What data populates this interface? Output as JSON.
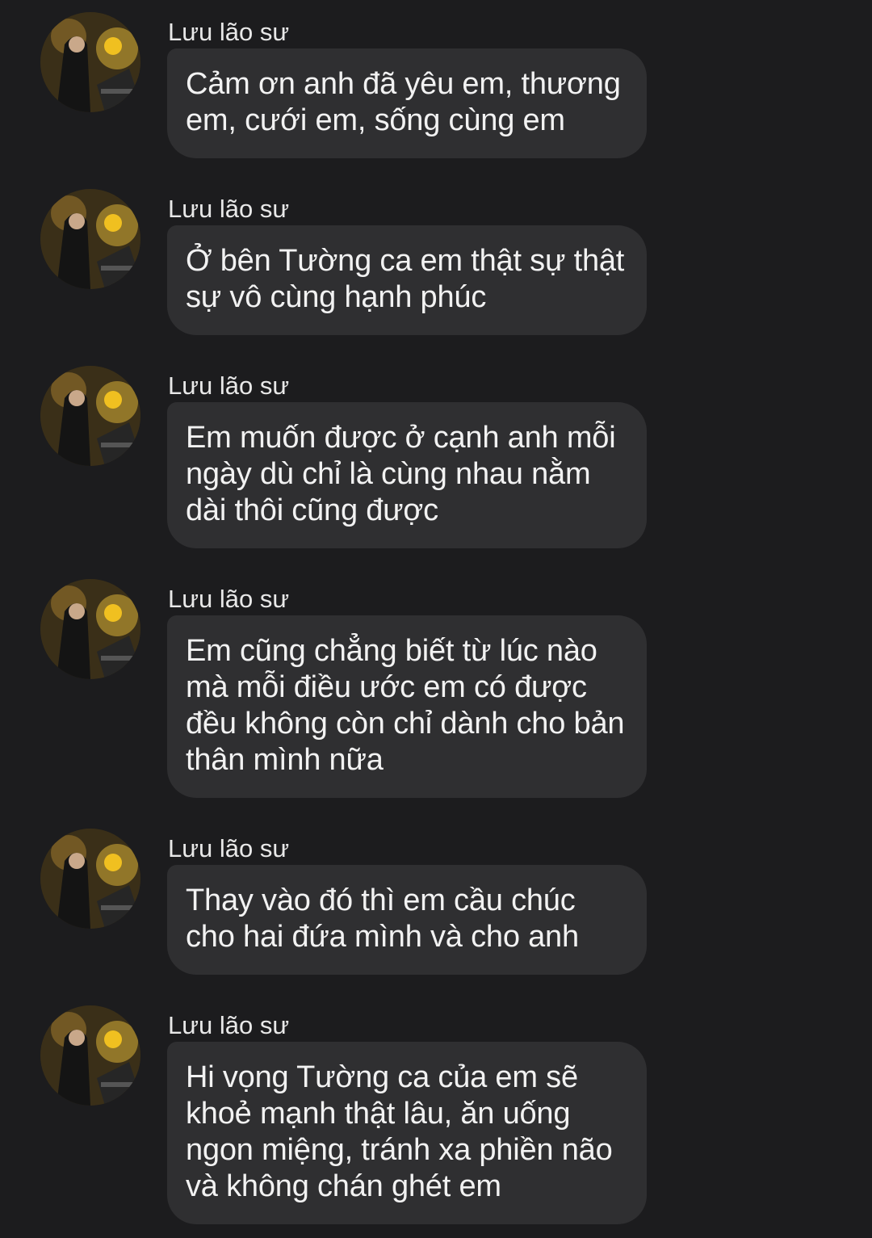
{
  "colors": {
    "background": "#1c1c1e",
    "bubble": "#2f2f31",
    "text": "#f2f2f2",
    "sender_name": "#e8e8e8"
  },
  "messages": [
    {
      "sender": "Lưu lão sư",
      "avatar_icon": "profile-photo-avatar",
      "text": "Cảm ơn anh đã yêu em, thương\nem, cưới em, sống cùng em"
    },
    {
      "sender": "Lưu lão sư",
      "avatar_icon": "profile-photo-avatar",
      "text": "Ở bên Tường ca em thật sự thật\nsự vô cùng hạnh phúc"
    },
    {
      "sender": "Lưu lão sư",
      "avatar_icon": "profile-photo-avatar",
      "text": "Em muốn được ở cạnh anh mỗi\nngày dù chỉ là cùng nhau nằm\ndài thôi cũng được"
    },
    {
      "sender": "Lưu lão sư",
      "avatar_icon": "profile-photo-avatar",
      "text": "Em cũng chẳng biết từ lúc nào\nmà mỗi điều ước em có được\nđều không còn chỉ dành cho bản\nthân mình nữa"
    },
    {
      "sender": "Lưu lão sư",
      "avatar_icon": "profile-photo-avatar",
      "text": "Thay vào đó thì em cầu chúc\ncho hai đứa mình và cho anh"
    },
    {
      "sender": "Lưu lão sư",
      "avatar_icon": "profile-photo-avatar",
      "text": "Hi vọng Tường ca của em sẽ\nkhoẻ mạnh thật lâu, ăn uống\nngon miệng, tránh xa phiền não\nvà không chán ghét em"
    }
  ]
}
